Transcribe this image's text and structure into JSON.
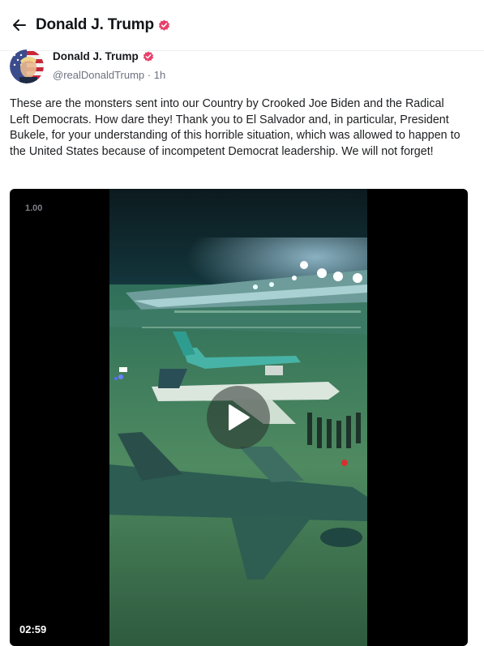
{
  "header": {
    "title": "Donald J. Trump",
    "back_icon": "arrow-left-icon",
    "verified_icon": "verified-badge-icon",
    "verified_color": "#e8406b"
  },
  "post": {
    "author": {
      "name": "Donald J. Trump",
      "handle": "@realDonaldTrump",
      "separator": "·",
      "time": "1h"
    },
    "text": "These are the monsters sent into our Country by Crooked Joe Biden and the Radical Left Democrats. How dare they! Thank you to El Salvador and, in particular, President Bukele, for your understanding of this horrible situation, which was allowed to happen to the United States because of incompetent Democrat leadership. We will not forget!",
    "video": {
      "speed": "1.00",
      "duration": "02:59",
      "play_icon": "play-icon"
    }
  }
}
